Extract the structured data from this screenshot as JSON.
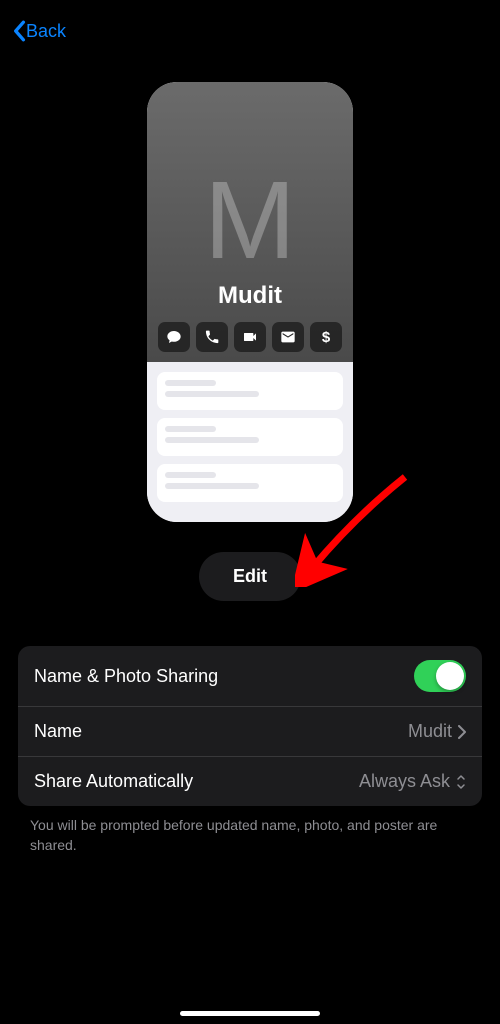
{
  "nav": {
    "back_label": "Back"
  },
  "card": {
    "monogram": "M",
    "name": "Mudit"
  },
  "edit": {
    "label": "Edit"
  },
  "settings": {
    "sharing": {
      "label": "Name & Photo Sharing",
      "enabled": true
    },
    "name": {
      "label": "Name",
      "value": "Mudit"
    },
    "share_auto": {
      "label": "Share Automatically",
      "value": "Always Ask"
    }
  },
  "footer": "You will be prompted before updated name, photo, and poster are shared.",
  "icons": {
    "message": "message-icon",
    "phone": "phone-icon",
    "video": "video-icon",
    "mail": "mail-icon",
    "pay": "pay-icon"
  }
}
